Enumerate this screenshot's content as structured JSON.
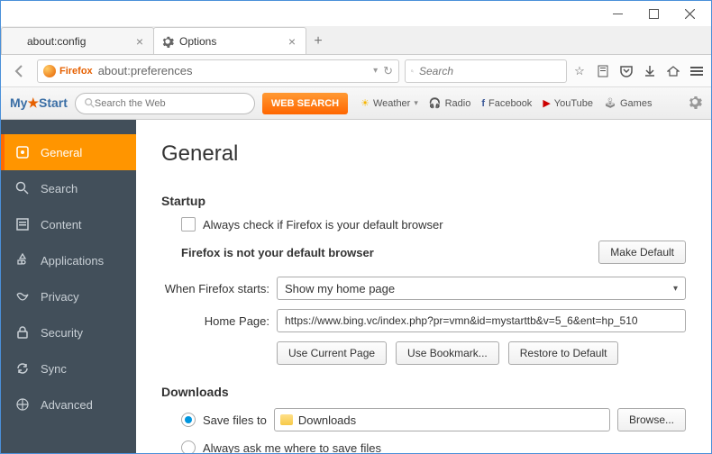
{
  "window": {
    "tabs": [
      {
        "title": "about:config"
      },
      {
        "title": "Options"
      }
    ]
  },
  "navbar": {
    "identity_label": "Firefox",
    "url": "about:preferences",
    "search_placeholder": "Search"
  },
  "mystart": {
    "logo": "MyStart",
    "search_placeholder": "Search the Web",
    "button": "WEB SEARCH",
    "links": [
      "Weather",
      "Radio",
      "Facebook",
      "YouTube",
      "Games"
    ]
  },
  "sidebar": {
    "items": [
      {
        "label": "General"
      },
      {
        "label": "Search"
      },
      {
        "label": "Content"
      },
      {
        "label": "Applications"
      },
      {
        "label": "Privacy"
      },
      {
        "label": "Security"
      },
      {
        "label": "Sync"
      },
      {
        "label": "Advanced"
      }
    ]
  },
  "pane": {
    "title": "General",
    "startup": {
      "heading": "Startup",
      "always_check": "Always check if Firefox is your default browser",
      "not_default": "Firefox is not your default browser",
      "make_default": "Make Default",
      "when_starts_label": "When Firefox starts:",
      "when_starts_value": "Show my home page",
      "home_page_label": "Home Page:",
      "home_page_value": "https://www.bing.vc/index.php?pr=vmn&id=mystarttb&v=5_6&ent=hp_510",
      "use_current": "Use Current Page",
      "use_bookmark": "Use Bookmark...",
      "restore_default": "Restore to Default"
    },
    "downloads": {
      "heading": "Downloads",
      "save_to": "Save files to",
      "path": "Downloads",
      "browse": "Browse...",
      "always_ask": "Always ask me where to save files"
    }
  }
}
